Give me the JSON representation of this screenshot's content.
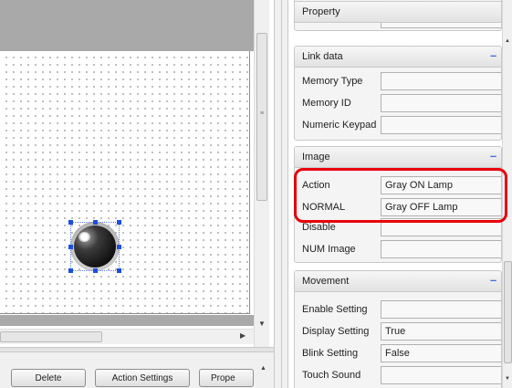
{
  "canvas": {
    "object_name": "gray-lamp"
  },
  "toolbar": {
    "delete_label": "Delete",
    "action_settings_label": "Action Settings",
    "property_label": "Prope"
  },
  "panel": {
    "top_group": {
      "title": "Property"
    },
    "link_data": {
      "title": "Link data",
      "collapse": "–",
      "rows": [
        {
          "label": "Memory Type",
          "value": ""
        },
        {
          "label": "Memory ID",
          "value": ""
        },
        {
          "label": "Numeric Keypad",
          "value": ""
        }
      ]
    },
    "image": {
      "title": "Image",
      "collapse": "–",
      "rows": [
        {
          "label": "Action",
          "value": "Gray ON Lamp"
        },
        {
          "label": "NORMAL",
          "value": "Gray OFF Lamp"
        },
        {
          "label": "Disable",
          "value": ""
        },
        {
          "label": "NUM Image",
          "value": ""
        }
      ]
    },
    "movement": {
      "title": "Movement",
      "collapse": "–",
      "rows": [
        {
          "label": "Enable Setting",
          "value": ""
        },
        {
          "label": "Display Setting",
          "value": "True"
        },
        {
          "label": "Blink Setting",
          "value": "False"
        },
        {
          "label": "Touch Sound",
          "value": ""
        }
      ]
    }
  },
  "colors": {
    "highlight": "#e8000b",
    "selection_handle": "#1b4fe0",
    "collapse_accent": "#3c6fd8"
  }
}
